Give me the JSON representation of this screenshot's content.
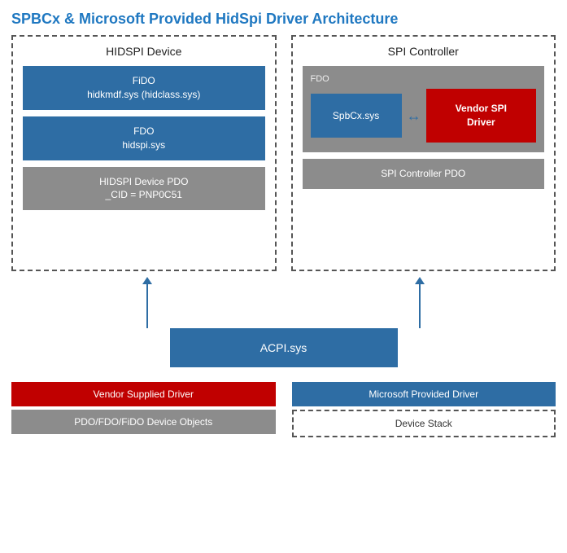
{
  "title": "SPBCx & Microsoft Provided HidSpi Driver Architecture",
  "hidspi_device": {
    "label": "HIDSPI Device",
    "block1_line1": "FiDO",
    "block1_line2": "hidkmdf.sys (hidclass.sys)",
    "block2_line1": "FDO",
    "block2_line2": "hidspi.sys",
    "block3_line1": "HIDSPI Device PDO",
    "block3_line2": "_CID = PNP0C51"
  },
  "spi_controller": {
    "label": "SPI Controller",
    "fdo_label": "FDO",
    "spbcx_label": "SpbCx.sys",
    "vendor_spi_line1": "Vendor SPI",
    "vendor_spi_line2": "Driver",
    "pdo_label": "SPI Controller PDO"
  },
  "acpi": {
    "label": "ACPI.sys"
  },
  "legend": {
    "vendor_label": "Vendor Supplied Driver",
    "pdo_label": "PDO/FDO/FiDO Device Objects",
    "microsoft_label": "Microsoft Provided Driver",
    "device_stack_label": "Device Stack"
  }
}
